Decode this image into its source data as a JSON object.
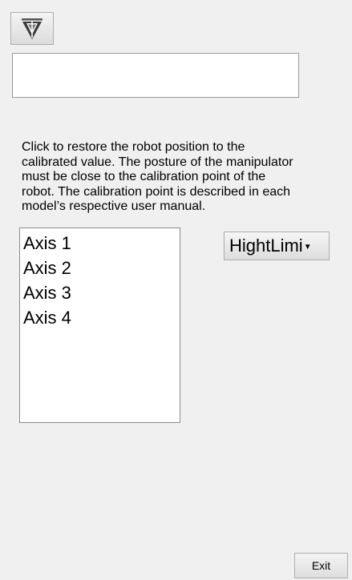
{
  "logo_button": {
    "icon": "robot-logo-icon"
  },
  "text_box": {
    "value": ""
  },
  "description": "Click to restore the robot position to the\ncalibrated value. The posture of the manipulator\nmust be close to the calibration point of the\nrobot. The calibration point is described in each\nmodel’s respective user manual.",
  "axis_list": {
    "items": [
      "Axis 1",
      "Axis 2",
      "Axis 3",
      "Axis 4"
    ]
  },
  "limit_select": {
    "selected": "HightLimi",
    "caret_icon": "chevron-down-icon"
  },
  "exit_button": {
    "label": "Exit"
  }
}
